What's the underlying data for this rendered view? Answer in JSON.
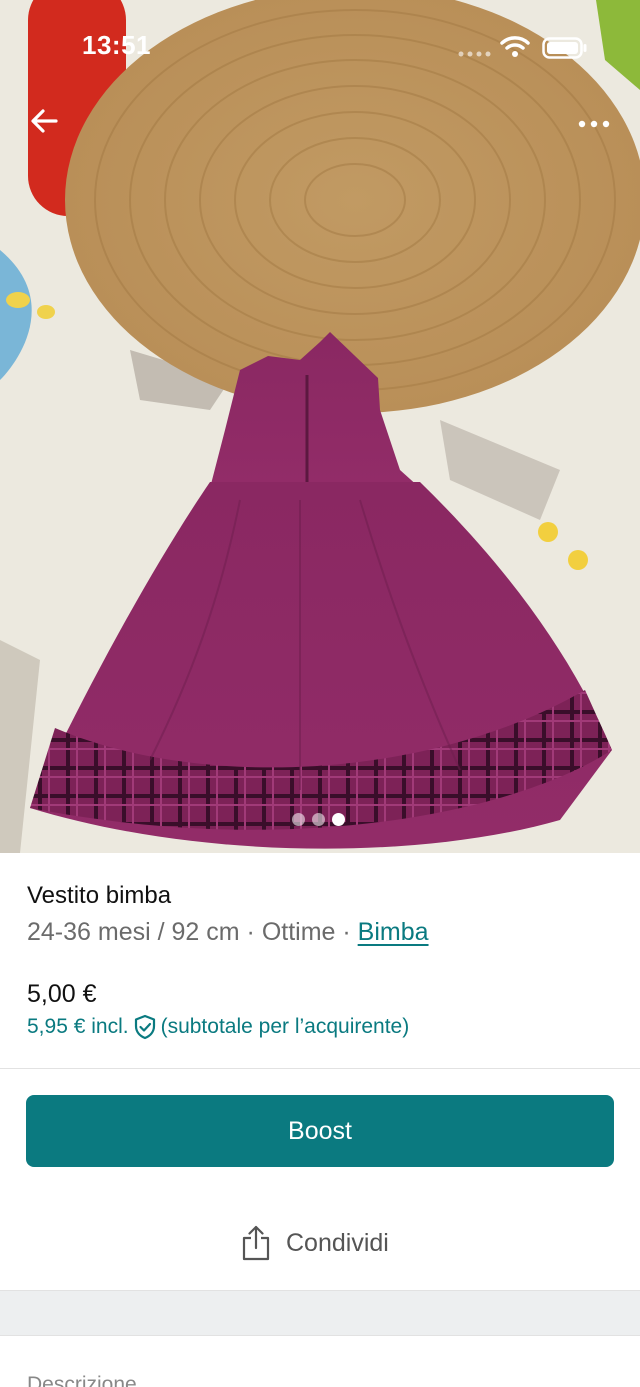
{
  "status_bar": {
    "time": "13:51",
    "icons": [
      "signal-icon",
      "wifi-icon",
      "battery-icon"
    ]
  },
  "navigation": {
    "back_icon": "arrow-left-icon",
    "more_icon": "more-horizontal-icon"
  },
  "gallery": {
    "photo_count": 3,
    "active_index": 2
  },
  "item": {
    "title": "Vestito bimba",
    "size": "24-36 mesi / 92 cm",
    "separator": " · ",
    "condition": "Ottime",
    "category": "Bimba",
    "price": "5,00 €",
    "price_incl": "5,95 € incl.",
    "price_incl_note": "(subtotale per l’acquirente)",
    "protection_icon": "shield-check-icon"
  },
  "actions": {
    "boost_label": "Boost",
    "share_label": "Condividi",
    "share_icon": "share-icon"
  },
  "description": {
    "label": "Descrizione"
  },
  "colors": {
    "accent": "#0b7a80",
    "link": "#0a7a80",
    "dress": "#8e2a63"
  }
}
